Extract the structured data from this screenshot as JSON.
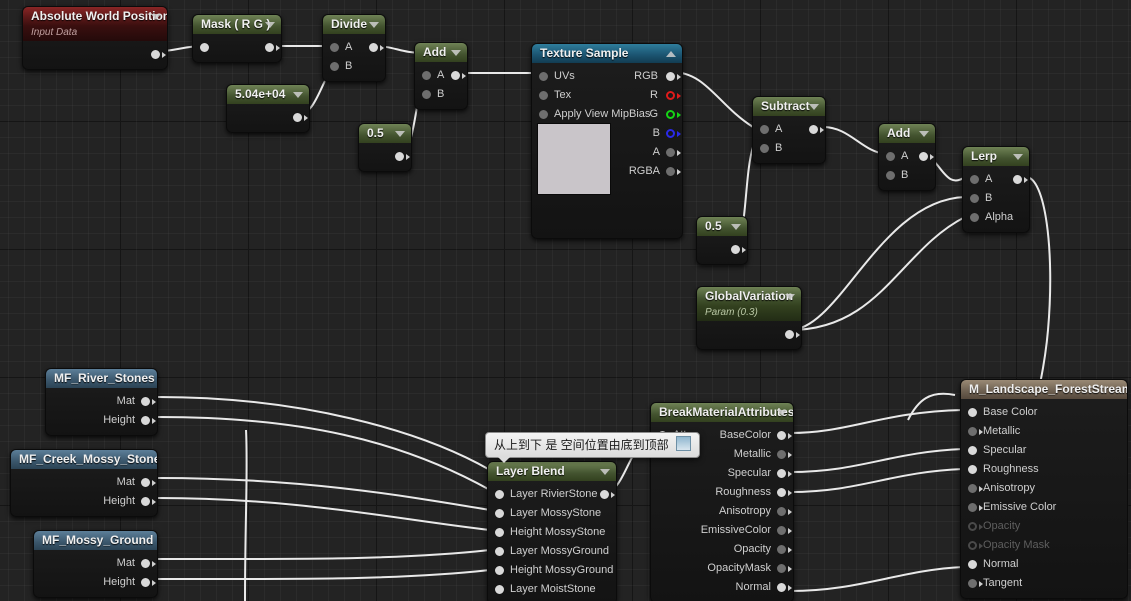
{
  "editor": {
    "name": "unreal-material-graph",
    "background_color": "#232323",
    "grid_color": "#2c2c2c",
    "wire_color": "#e8e8e8"
  },
  "tooltip": {
    "text": "从上到下 是 空间位置由底到顶部",
    "icon": "note-icon"
  },
  "nodes": [
    {
      "id": "absolute-world-position",
      "title": "Absolute World Position",
      "subtitle": "Input Data",
      "header_color": "#5b1818",
      "inputs": [],
      "outputs": [
        ""
      ]
    },
    {
      "id": "mask-rg",
      "title": "Mask ( R G )",
      "header_color": "#43532f",
      "inputs": [
        ""
      ],
      "outputs": [
        ""
      ]
    },
    {
      "id": "divide",
      "title": "Divide",
      "header_color": "#43532f",
      "inputs": [
        "A",
        "B"
      ],
      "outputs": [
        ""
      ]
    },
    {
      "id": "constant-50400",
      "title": "5.04e+04",
      "header_color": "#43532f",
      "inputs": [],
      "outputs": [
        ""
      ]
    },
    {
      "id": "add-1",
      "title": "Add",
      "header_color": "#43532f",
      "inputs": [
        "A",
        "B"
      ],
      "outputs": [
        ""
      ]
    },
    {
      "id": "constant-half-1",
      "title": "0.5",
      "header_color": "#43532f",
      "inputs": [],
      "outputs": [
        ""
      ]
    },
    {
      "id": "texture-sample",
      "title": "Texture Sample",
      "header_color": "#1c5673",
      "inputs": [
        "UVs",
        "Tex",
        "Apply View MipBias"
      ],
      "outputs": [
        "RGB",
        "R",
        "G",
        "B",
        "A",
        "RGBA"
      ]
    },
    {
      "id": "subtract",
      "title": "Subtract",
      "header_color": "#43532f",
      "inputs": [
        "A",
        "B"
      ],
      "outputs": [
        ""
      ]
    },
    {
      "id": "constant-half-2",
      "title": "0.5",
      "header_color": "#43532f",
      "inputs": [],
      "outputs": [
        ""
      ]
    },
    {
      "id": "global-variation",
      "title": "GlobalVariation",
      "subtitle": "Param (0.3)",
      "header_color": "#43532f",
      "inputs": [],
      "outputs": [
        ""
      ]
    },
    {
      "id": "add-2",
      "title": "Add",
      "header_color": "#43532f",
      "inputs": [
        "A",
        "B"
      ],
      "outputs": [
        ""
      ]
    },
    {
      "id": "lerp",
      "title": "Lerp",
      "header_color": "#43532f",
      "inputs": [
        "A",
        "B",
        "Alpha"
      ],
      "outputs": [
        ""
      ]
    },
    {
      "id": "mf-river-stones",
      "title": "MF_River_Stones",
      "header_color": "#3a566b",
      "inputs": [],
      "outputs": [
        "Mat",
        "Height"
      ]
    },
    {
      "id": "mf-creek-mossy-stones",
      "title": "MF_Creek_Mossy_Stones",
      "header_color": "#3a566b",
      "inputs": [],
      "outputs": [
        "Mat",
        "Height"
      ]
    },
    {
      "id": "mf-mossy-ground",
      "title": "MF_Mossy_Ground",
      "header_color": "#3a566b",
      "inputs": [],
      "outputs": [
        "Mat",
        "Height"
      ]
    },
    {
      "id": "layer-blend",
      "title": "Layer Blend",
      "header_color": "#43532f",
      "inputs": [
        "Layer RivierStone",
        "Layer MossyStone",
        "Height MossyStone",
        "Layer MossyGround",
        "Height MossyGround",
        "Layer MoistStone"
      ],
      "outputs": [
        ""
      ]
    },
    {
      "id": "break-material-attributes",
      "title": "BreakMaterialAttributes",
      "header_color": "#43532f",
      "inputs": [
        "Attr"
      ],
      "outputs": [
        "BaseColor",
        "Metallic",
        "Specular",
        "Roughness",
        "Anisotropy",
        "EmissiveColor",
        "Opacity",
        "OpacityMask",
        "Normal"
      ]
    },
    {
      "id": "m-landscape-foreststream",
      "title": "M_Landscape_ForestStream",
      "header_color": "#6c5f50",
      "inputs": [
        "Base Color",
        "Metallic",
        "Specular",
        "Roughness",
        "Anisotropy",
        "Emissive Color",
        "Opacity",
        "Opacity Mask",
        "Normal",
        "Tangent"
      ],
      "outputs": []
    }
  ],
  "labels": {
    "awp_title": "Absolute World Position",
    "awp_sub": "Input Data",
    "mask_title": "Mask ( R G )",
    "divide_title": "Divide",
    "divide_a": "A",
    "divide_b": "B",
    "const_50400": "5.04e+04",
    "add1_title": "Add",
    "add1_a": "A",
    "add1_b": "B",
    "half1": "0.5",
    "tex_title": "Texture Sample",
    "tex_uvs": "UVs",
    "tex_tex": "Tex",
    "tex_mip": "Apply View MipBias",
    "tex_rgb": "RGB",
    "tex_r": "R",
    "tex_g": "G",
    "tex_b": "B",
    "tex_a": "A",
    "tex_rgba": "RGBA",
    "sub_title": "Subtract",
    "sub_a": "A",
    "sub_b": "B",
    "half2": "0.5",
    "gv_title": "GlobalVariation",
    "gv_sub": "Param (0.3)",
    "add2_title": "Add",
    "add2_a": "A",
    "add2_b": "B",
    "lerp_title": "Lerp",
    "lerp_a": "A",
    "lerp_b": "B",
    "lerp_alpha": "Alpha",
    "mf1_title": "MF_River_Stones",
    "mf1_mat": "Mat",
    "mf1_height": "Height",
    "mf2_title": "MF_Creek_Mossy_Stones",
    "mf2_mat": "Mat",
    "mf2_height": "Height",
    "mf3_title": "MF_Mossy_Ground",
    "mf3_mat": "Mat",
    "mf3_height": "Height",
    "lb_title": "Layer Blend",
    "lb_i0": "Layer RivierStone",
    "lb_i1": "Layer MossyStone",
    "lb_i2": "Height MossyStone",
    "lb_i3": "Layer MossyGround",
    "lb_i4": "Height MossyGround",
    "lb_i5": "Layer MoistStone",
    "bma_title": "BreakMaterialAttributes",
    "bma_attr": "Attr",
    "bma_o0": "BaseColor",
    "bma_o1": "Metallic",
    "bma_o2": "Specular",
    "bma_o3": "Roughness",
    "bma_o4": "Anisotropy",
    "bma_o5": "EmissiveColor",
    "bma_o6": "Opacity",
    "bma_o7": "OpacityMask",
    "bma_o8": "Normal",
    "mat_title": "M_Landscape_ForestStream",
    "mat_i0": "Base Color",
    "mat_i1": "Metallic",
    "mat_i2": "Specular",
    "mat_i3": "Roughness",
    "mat_i4": "Anisotropy",
    "mat_i5": "Emissive Color",
    "mat_i6": "Opacity",
    "mat_i7": "Opacity Mask",
    "mat_i8": "Normal",
    "mat_i9": "Tangent",
    "tooltip_text": "从上到下 是 空间位置由底到顶部"
  }
}
